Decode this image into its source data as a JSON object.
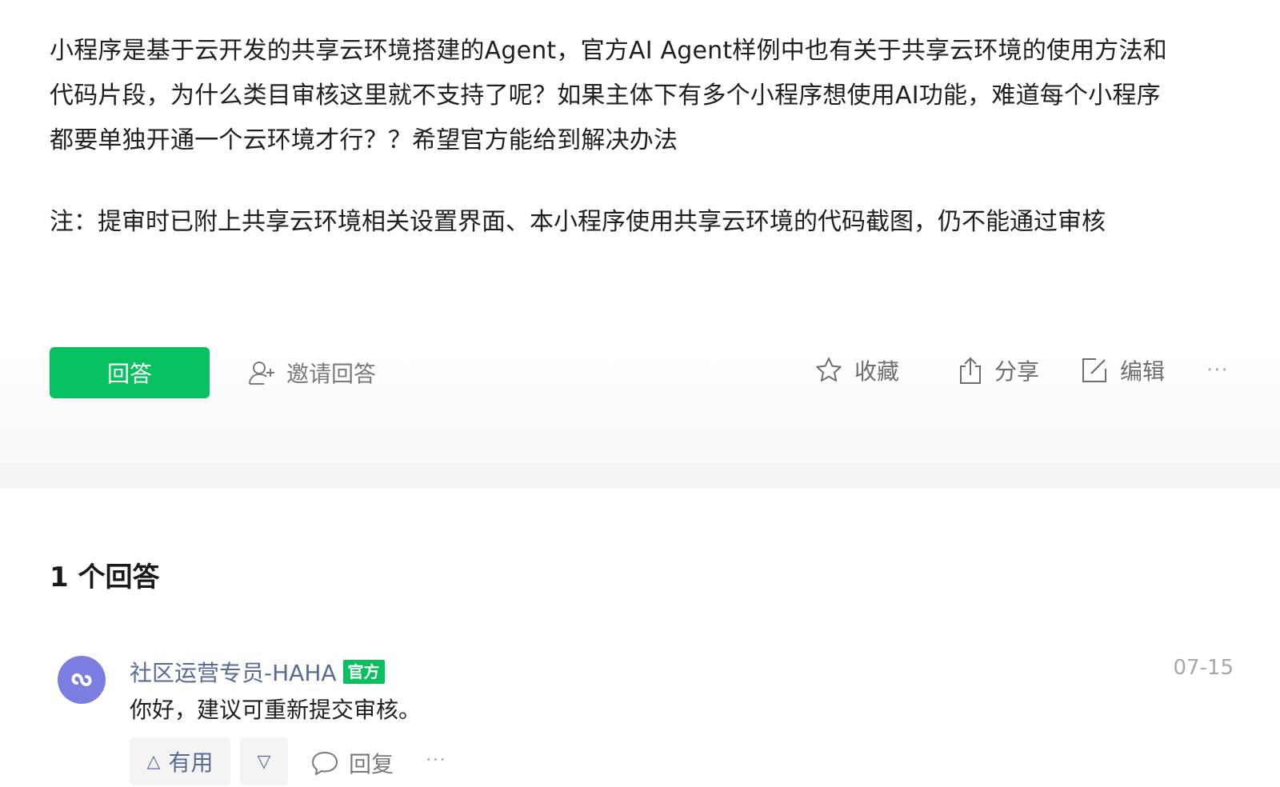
{
  "question": {
    "body_lines": [
      "小程序是基于云开发的共享云环境搭建的Agent，官方AI Agent样例中也有关于共享云环境的使用方法和",
      "代码片段，为什么类目审核这里就不支持了呢？如果主体下有多个小程序想使用AI功能，难道每个小程序",
      "都要单独开通一个云环境才行？？希望官方能给到解决办法"
    ],
    "note": "注：提审时已附上共享云环境相关设置界面、本小程序使用共享云环境的代码截图，仍不能通过审核"
  },
  "actions": {
    "answer_label": "回答",
    "invite_label": "邀请回答",
    "favorite_label": "收藏",
    "share_label": "分享",
    "edit_label": "编辑",
    "more_label": "···"
  },
  "answers": {
    "title": "1 个回答",
    "items": [
      {
        "author": "社区运营专员-HAHA",
        "badge": "官方",
        "date": "07-15",
        "text": "你好，建议可重新提交审核。",
        "useful_label": "有用",
        "up_symbol": "△",
        "down_symbol": "▽",
        "reply_label": "回复",
        "more_label": "···"
      }
    ]
  },
  "colors": {
    "brand_green": "#07c160",
    "author_blue": "#576b95",
    "avatar_purple": "#7b7ee0"
  }
}
